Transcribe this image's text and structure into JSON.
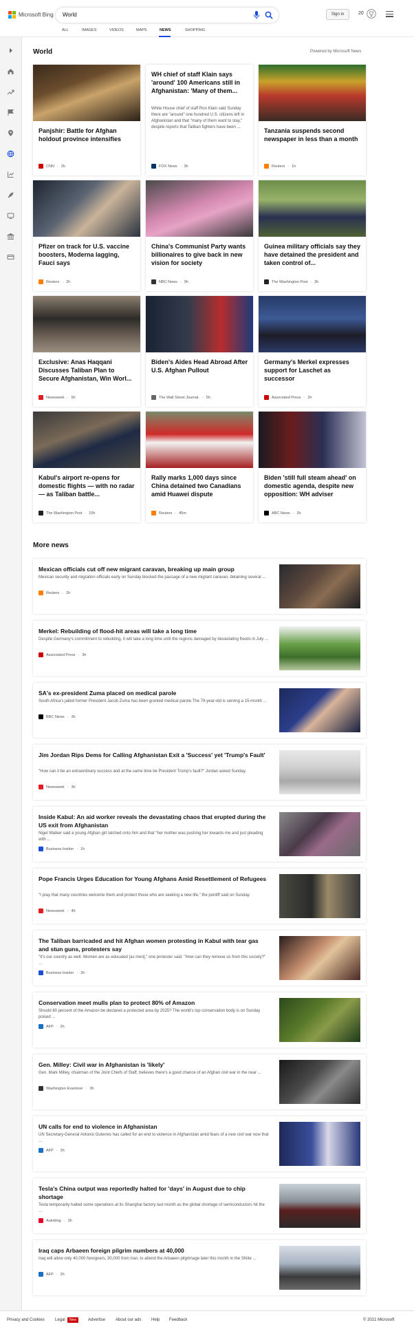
{
  "brand": {
    "logo_text": "Microsoft Bing",
    "colors": [
      "#f25022",
      "#7fba00",
      "#00a4ef",
      "#ffb900"
    ]
  },
  "search": {
    "query": "World"
  },
  "tabs": [
    {
      "label": "ALL"
    },
    {
      "label": "IMAGES"
    },
    {
      "label": "VIDEOS"
    },
    {
      "label": "MAPS"
    },
    {
      "label": "NEWS",
      "active": true
    },
    {
      "label": "SHOPPING"
    }
  ],
  "header": {
    "sign_in": "Sign in",
    "rewards_count": "20",
    "accent": "#174ae4"
  },
  "sidebar": {
    "icons": [
      "expand-icon",
      "home-icon",
      "trending-icon",
      "flag-icon",
      "location-pin-icon",
      "globe-icon",
      "chart-icon",
      "rocket-icon",
      "tv-icon",
      "bank-icon",
      "card-icon"
    ]
  },
  "world": {
    "title": "World",
    "powered": "Powered by Microsoft News",
    "cards": [
      {
        "title": "Panjshir: Battle for Afghan holdout province intensifies",
        "source": "CNN",
        "time": "2h",
        "badge": "#cc0000"
      },
      {
        "title": "WH chief of staff Klain says 'around' 100 Americans still in Afghanistan: 'Many of them...",
        "snippet": "White House chief of staff Ron Klain said Sunday there are \"around\" one hundred U.S. citizens left in Afghanistan and that \"many of them want to stay,\" despite reports that Taliban fighters have been ...",
        "source": "FOX News",
        "time": "3h",
        "badge": "#003366"
      },
      {
        "title": "Tanzania suspends second newspaper in less than a month",
        "source": "Reuters",
        "time": "1h",
        "badge": "#ff8000"
      },
      {
        "title": "Pfizer on track for U.S. vaccine boosters, Moderna lagging, Fauci says",
        "source": "Reuters",
        "time": "2h",
        "badge": "#ff8000"
      },
      {
        "title": "China's Communist Party wants billionaires to give back in new vision for society",
        "source": "NBC News",
        "time": "9h",
        "badge": "#333333"
      },
      {
        "title": "Guinea military officials say they have detained the president and taken control of...",
        "source": "The Washington Post",
        "time": "3h",
        "badge": "#222222"
      },
      {
        "title": "Exclusive: Anas Haqqani Discusses Taliban Plan to Secure Afghanistan, Win Worl...",
        "source": "Newsweek",
        "time": "5h",
        "badge": "#e31b23"
      },
      {
        "title": "Biden's Aides Head Abroad After U.S. Afghan Pullout",
        "source": "The Wall Street Journal.",
        "time": "5h",
        "badge": "#666666"
      },
      {
        "title": "Germany's Merkel expresses support for Laschet as successor",
        "source": "Associated Press",
        "time": "2h",
        "badge": "#cc0000"
      },
      {
        "title": "Kabul's airport re-opens for domestic flights — with no radar — as Taliban battle...",
        "source": "The Washington Post",
        "time": "10h",
        "badge": "#222222"
      },
      {
        "title": "Rally marks 1,000 days since China detained two Canadians amid Huawei dispute",
        "source": "Reuters",
        "time": "45m",
        "badge": "#ff8000"
      },
      {
        "title": "Biden 'still full steam ahead' on domestic agenda, despite new opposition: WH adviser",
        "source": "ABC News",
        "time": "2h",
        "badge": "#000000"
      }
    ]
  },
  "more_news": {
    "title": "More news",
    "items": [
      {
        "title": "Mexican officials cut off new migrant caravan, breaking up main group",
        "snippet": "Mexican security and migration officials early on Sunday blocked the passage of a new migrant caravan, detaining several ...",
        "source": "Reuters",
        "time": "2h",
        "badge": "#ff8000"
      },
      {
        "title": "Merkel: Rebuilding of flood-hit areas will take a long time",
        "snippet": "Despite Germany's commitment to rebuilding, it will take a long time until the regions damaged by devastating floods in July ...",
        "source": "Associated Press",
        "time": "3h",
        "badge": "#cc0000"
      },
      {
        "title": "SA's ex-president Zuma placed on medical parole",
        "snippet": "South Africa's jailed former President Jacob Zuma has been granted medical parole.The 79-year-old is serving a 15-month ...",
        "source": "BBC News",
        "time": "3h",
        "badge": "#000000"
      },
      {
        "title": "Jim Jordan Rips Dems for Calling Afghanistan Exit a 'Success' yet 'Trump's Fault'",
        "snippet": "\"How can it be an extraordinary success and at the same time be President Trump's fault?\" Jordan asked Sunday.",
        "source": "Newsweek",
        "time": "3h",
        "badge": "#e31b23"
      },
      {
        "title": "Inside Kabul: An aid worker reveals the devastating chaos that erupted during the US exit from Afghanistan",
        "snippet": "Nigel Walker said a young Afghan girl latched onto him and that \"her mother was pushing her towards me and just pleading with ...",
        "source": "Business Insider",
        "time": "1h",
        "badge": "#1a4fd6"
      },
      {
        "title": "Pope Francis Urges Education for Young Afghans Amid Resettlement of Refugees",
        "snippet": "\"I pray that many countries welcome them and protect those who are seeking a new life,\" the pontiff said on Sunday.",
        "source": "Newsweek",
        "time": "4h",
        "badge": "#e31b23"
      },
      {
        "title": "The Taliban barricaded and hit Afghan women protesting in Kabul with tear gas and stun guns, protesters say",
        "snippet": "\"It's our country as well. Women are as educated [as men],\" one protester said. \"How can they remove us from this society?\" ...",
        "source": "Business Insider",
        "time": "2h",
        "badge": "#1a4fd6"
      },
      {
        "title": "Conservation meet mulls plan to protect 80% of Amazon",
        "snippet": "Should 80 percent of the Amazon be declared a protected area by 2025? The world's top conservation body is on Sunday poised ...",
        "source": "AFP",
        "time": "2h",
        "badge": "#1a6fc2"
      },
      {
        "title": "Gen. Milley: Civil war in Afghanistan is 'likely'",
        "snippet": "Gen. Mark Milley, chairman of the Joint Chiefs of Staff, believes there's a good chance of an Afghan civil war in the near ...",
        "source": "Washington Examiner",
        "time": "3h",
        "badge": "#333333"
      },
      {
        "title": "UN calls for end to violence in Afghanistan",
        "snippet": "UN Secretary-General Antonio Guterres has called for an end to violence in Afghanistan amid fears of a new civil war now that ...",
        "source": "AFP",
        "time": "3h",
        "badge": "#1a6fc2"
      },
      {
        "title": "Tesla's China output was reportedly halted for 'days' in August due to chip shortage",
        "snippet": "Tesla temporarily halted some operations at its Shanghai factory last month as the global shortage of semiconductors hit the ...",
        "source": "Autoblog",
        "time": "3h",
        "badge": "#e4002b"
      },
      {
        "title": "Iraq caps Arbaeen foreign pilgrim numbers at 40,000",
        "snippet": "Iraq will allow only 40,000 foreigners, 30,000 from Iran, to attend the Arbaeen pilgrimage later this month in the Shiite ...",
        "source": "AFP",
        "time": "2h",
        "badge": "#1a6fc2"
      }
    ]
  },
  "footer": {
    "links": [
      "Privacy and Cookies",
      "Legal",
      "Advertise",
      "About our ads",
      "Help",
      "Feedback"
    ],
    "new_badge": "New",
    "copyright": "© 2021 Microsoft"
  }
}
